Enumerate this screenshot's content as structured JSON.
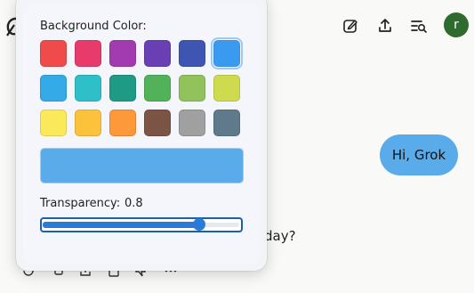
{
  "chat": {
    "user_message": "Hi, Grok",
    "assistant_fragment": "day?",
    "avatar_letter": "r"
  },
  "toolbar": {
    "icons": [
      "edit-icon",
      "share-upload-icon",
      "search-history-icon"
    ]
  },
  "color_picker": {
    "background_label": "Background Color:",
    "swatches": [
      "#ef4b4b",
      "#e63b6b",
      "#a23bb0",
      "#6a3fb4",
      "#3f55b2",
      "#3a9af0",
      "#34aae9",
      "#2fbfc9",
      "#1f9a84",
      "#52b25a",
      "#92c25b",
      "#cfdb4f",
      "#fbe85b",
      "#fcc23b",
      "#fd983b",
      "#7b5446",
      "#a0a0a0",
      "#5f7b8b"
    ],
    "selected_index": 5,
    "preview_color": "#5aabea",
    "transparency_label": "Transparency:",
    "transparency_value": "0.8",
    "transparency_level": 0.8
  },
  "colors": {
    "accent": "#2a7ad8",
    "avatar_bg": "#2f6b2f",
    "bubble": "#5aabea"
  }
}
